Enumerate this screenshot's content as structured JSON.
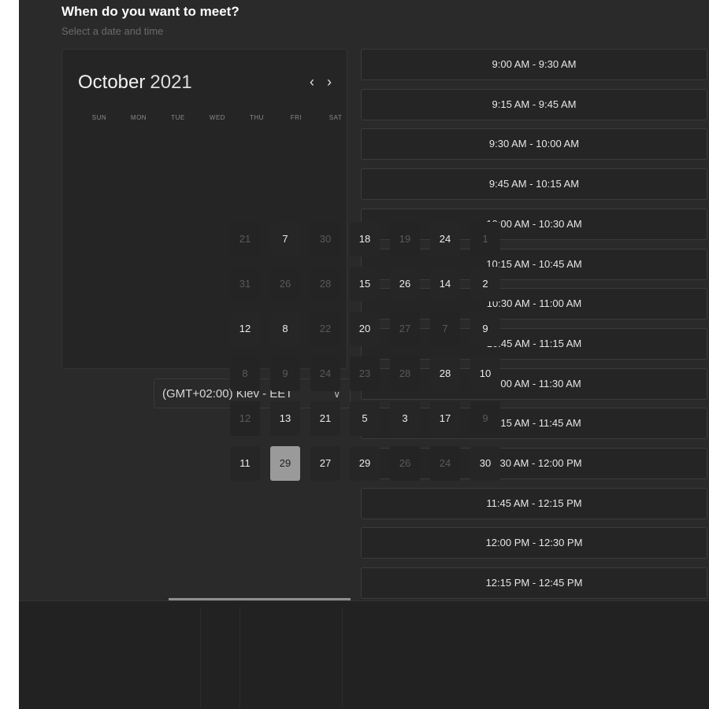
{
  "header": {
    "title": "When do you want to meet?",
    "subtitle": "Select a date and time"
  },
  "calendar": {
    "month": "October",
    "year": "2021",
    "prev_icon": "chevron-left-icon",
    "next_icon": "chevron-right-icon",
    "prev_glyph": "‹",
    "next_glyph": "›",
    "weekdays": [
      "SUN",
      "MON",
      "TUE",
      "WED",
      "THU",
      "FRI",
      "SAT"
    ],
    "selected_day": "29",
    "day_grid": [
      [
        "21",
        "7",
        "30",
        "18",
        "19",
        "24",
        "1"
      ],
      [
        "31",
        "26",
        "28",
        "15",
        "26",
        "14",
        "2"
      ],
      [
        "12",
        "8",
        "22",
        "20",
        "27",
        "7",
        "9"
      ],
      [
        "8",
        "9",
        "24",
        "23",
        "28",
        "28",
        "10"
      ],
      [
        "12",
        "13",
        "21",
        "5",
        "3",
        "17",
        "9"
      ],
      [
        "11",
        "29",
        "27",
        "29",
        "26",
        "24",
        "30"
      ]
    ],
    "muted_grid": [
      [
        true,
        false,
        true,
        false,
        true,
        false,
        true
      ],
      [
        true,
        true,
        true,
        false,
        false,
        false,
        false
      ],
      [
        false,
        false,
        true,
        false,
        true,
        true,
        false
      ],
      [
        true,
        true,
        true,
        true,
        true,
        false,
        false
      ],
      [
        true,
        false,
        false,
        false,
        false,
        false,
        true
      ],
      [
        false,
        false,
        false,
        false,
        true,
        true,
        false
      ]
    ]
  },
  "timezone": {
    "value": "(GMT+02:00) Kiev - EET",
    "chevron_icon": "chevron-down-icon",
    "chevron_glyph": "∨"
  },
  "time_slots": [
    "9:00 AM - 9:30 AM",
    "9:15 AM - 9:45 AM",
    "9:30 AM - 10:00 AM",
    "9:45 AM - 10:15 AM",
    "10:00 AM - 10:30 AM",
    "10:15 AM - 10:45 AM",
    "10:30 AM - 11:00 AM",
    "10:45 AM - 11:15 AM",
    "11:00 AM - 11:30 AM",
    "11:15 AM - 11:45 AM",
    "11:30 AM - 12:00 PM",
    "11:45 AM - 12:15 PM",
    "12:00 PM - 12:30 PM",
    "12:15 PM - 12:45 PM"
  ],
  "colors": {
    "background": "#2a2a2a",
    "panel": "#252525",
    "border": "#3b3b3b",
    "text": "#e6e6e6",
    "muted_text": "#5a5a5a",
    "selected": "#9a9a9a"
  }
}
